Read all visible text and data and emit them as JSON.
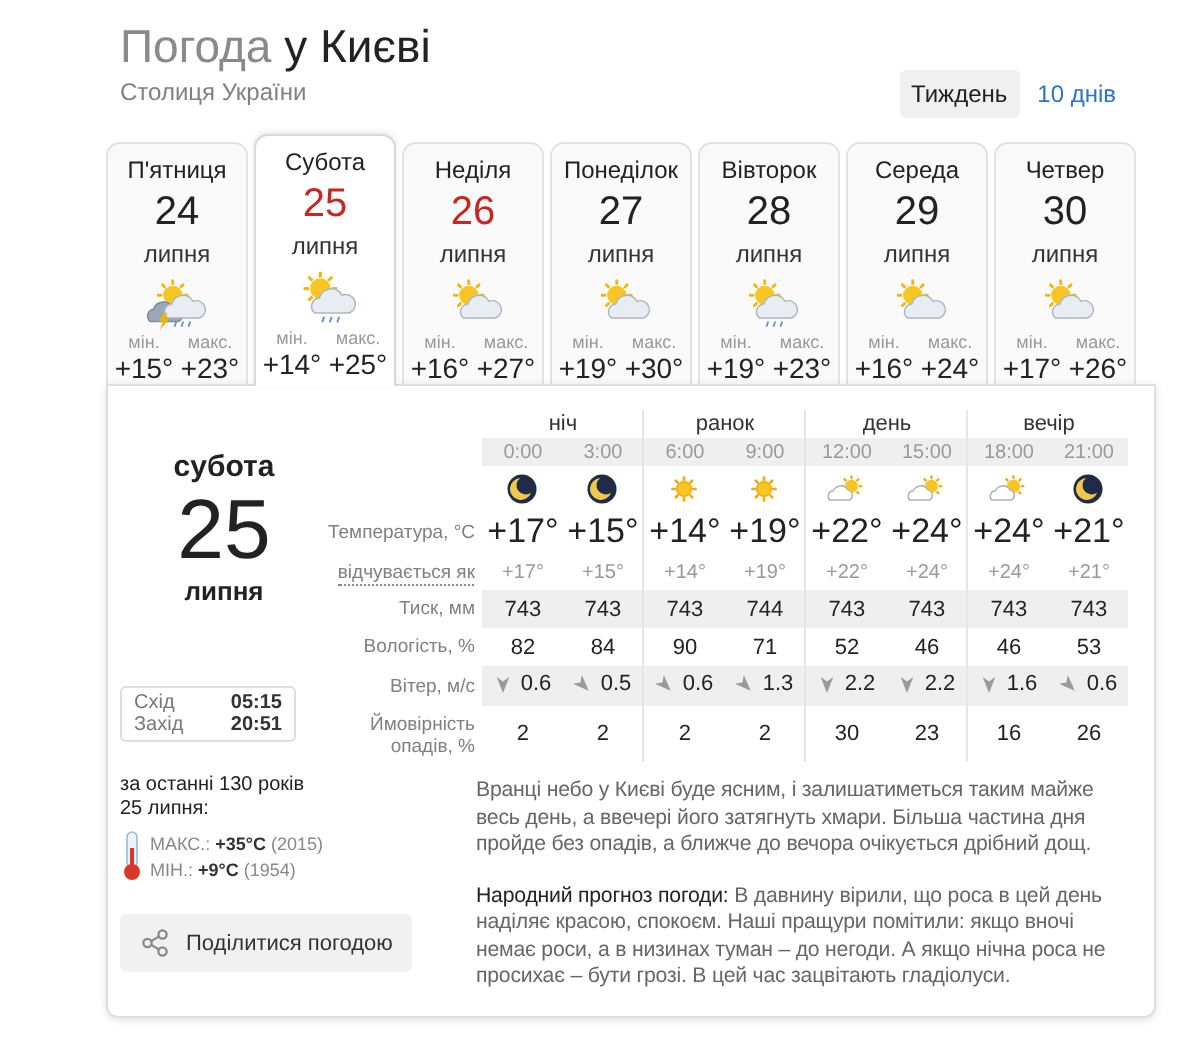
{
  "header": {
    "title_prefix": "Погода",
    "title_city": "у Києві",
    "subtitle": "Столиця України"
  },
  "range_tabs": [
    {
      "label": "Тиждень",
      "selected": true
    },
    {
      "label": "10 днів",
      "selected": false
    }
  ],
  "days": [
    {
      "weekday": "П'ятниця",
      "date": "24",
      "month": "липня",
      "weekend": false,
      "selected": false,
      "kind": "storm",
      "min_label": "мін.",
      "max_label": "макс.",
      "min": "+15°",
      "max": "+23°"
    },
    {
      "weekday": "Субота",
      "date": "25",
      "month": "липня",
      "weekend": true,
      "selected": true,
      "kind": "rain",
      "min_label": "мін.",
      "max_label": "макс.",
      "min": "+14°",
      "max": "+25°"
    },
    {
      "weekday": "Неділя",
      "date": "26",
      "month": "липня",
      "weekend": true,
      "selected": false,
      "kind": "cloud",
      "min_label": "мін.",
      "max_label": "макс.",
      "min": "+16°",
      "max": "+27°"
    },
    {
      "weekday": "Понеділок",
      "date": "27",
      "month": "липня",
      "weekend": false,
      "selected": false,
      "kind": "cloud",
      "min_label": "мін.",
      "max_label": "макс.",
      "min": "+19°",
      "max": "+30°"
    },
    {
      "weekday": "Вівторок",
      "date": "28",
      "month": "липня",
      "weekend": false,
      "selected": false,
      "kind": "rain",
      "min_label": "мін.",
      "max_label": "макс.",
      "min": "+19°",
      "max": "+23°"
    },
    {
      "weekday": "Середа",
      "date": "29",
      "month": "липня",
      "weekend": false,
      "selected": false,
      "kind": "cloud",
      "min_label": "мін.",
      "max_label": "макс.",
      "min": "+16°",
      "max": "+24°"
    },
    {
      "weekday": "Четвер",
      "date": "30",
      "month": "липня",
      "weekend": false,
      "selected": false,
      "kind": "cloud",
      "min_label": "мін.",
      "max_label": "макс.",
      "min": "+17°",
      "max": "+26°"
    }
  ],
  "detail": {
    "weekday": "субота",
    "date": "25",
    "month": "липня",
    "sun": [
      {
        "label": "Схід",
        "time": "05:15"
      },
      {
        "label": "Захід",
        "time": "20:51"
      }
    ],
    "record_intro": [
      "за останні 130 років",
      "25 липня:"
    ],
    "records": [
      "МАКС.: **+35°C** (2015)",
      "МІН.: **+9°C** (1954)"
    ],
    "share": "Поділитися погодою"
  },
  "row_labels": {
    "temp": "Температура, °C",
    "feels": "відчувається як",
    "pressure": "Тиск, мм",
    "humidity": "Вологість, %",
    "wind": "Вітер, м/с",
    "precip": "Ймовірність опадів, %"
  },
  "periods": [
    {
      "label": "ніч",
      "hours": [
        {
          "time": "0:00",
          "kind": "moon",
          "temp": "+17°",
          "feels": "+17°",
          "pressure": "743",
          "humidity": "82",
          "wind": {
            "kind": "n",
            "speed": "0.6"
          },
          "precip": "2"
        },
        {
          "time": "3:00",
          "kind": "moon",
          "temp": "+15°",
          "feels": "+15°",
          "pressure": "743",
          "humidity": "84",
          "wind": {
            "kind": "nw",
            "speed": "0.5"
          },
          "precip": "2"
        }
      ]
    },
    {
      "label": "ранок",
      "hours": [
        {
          "time": "6:00",
          "kind": "sun",
          "temp": "+14°",
          "feels": "+14°",
          "pressure": "743",
          "humidity": "90",
          "wind": {
            "kind": "nw",
            "speed": "0.6"
          },
          "precip": "2"
        },
        {
          "time": "9:00",
          "kind": "sun",
          "temp": "+19°",
          "feels": "+19°",
          "pressure": "744",
          "humidity": "71",
          "wind": {
            "kind": "nw",
            "speed": "1.3"
          },
          "precip": "2"
        }
      ]
    },
    {
      "label": "день",
      "hours": [
        {
          "time": "12:00",
          "kind": "partly",
          "temp": "+22°",
          "feels": "+22°",
          "pressure": "743",
          "humidity": "52",
          "wind": {
            "kind": "n",
            "speed": "2.2"
          },
          "precip": "30"
        },
        {
          "time": "15:00",
          "kind": "partly",
          "temp": "+24°",
          "feels": "+24°",
          "pressure": "743",
          "humidity": "46",
          "wind": {
            "kind": "n",
            "speed": "2.2"
          },
          "precip": "23"
        }
      ]
    },
    {
      "label": "вечір",
      "hours": [
        {
          "time": "18:00",
          "kind": "partly",
          "temp": "+24°",
          "feels": "+24°",
          "pressure": "743",
          "humidity": "46",
          "wind": {
            "kind": "n",
            "speed": "1.6"
          },
          "precip": "16"
        },
        {
          "time": "21:00",
          "kind": "moon",
          "temp": "+21°",
          "feels": "+21°",
          "pressure": "743",
          "humidity": "53",
          "wind": {
            "kind": "nw",
            "speed": "0.6"
          },
          "precip": "26"
        }
      ]
    }
  ],
  "summary": "Вранці небо у Києві буде ясним, і залишатиметься таким майже весь день, а ввечері його затягнуть хмари. Більша частина дня пройде без опадів, а ближче до вечора очікується дрібний дощ.",
  "folk": {
    "lead": "Народний прогноз погоди:",
    "text": " В давнину вірили, що роса в цей день наділяє красою, спокоєм. Наші пращури помітили: якщо вночі немає роси, а в низинах туман – до негоди. А якщо нічна роса не просихає – бути грозі. В цей час зацвітають гладіолуси."
  }
}
